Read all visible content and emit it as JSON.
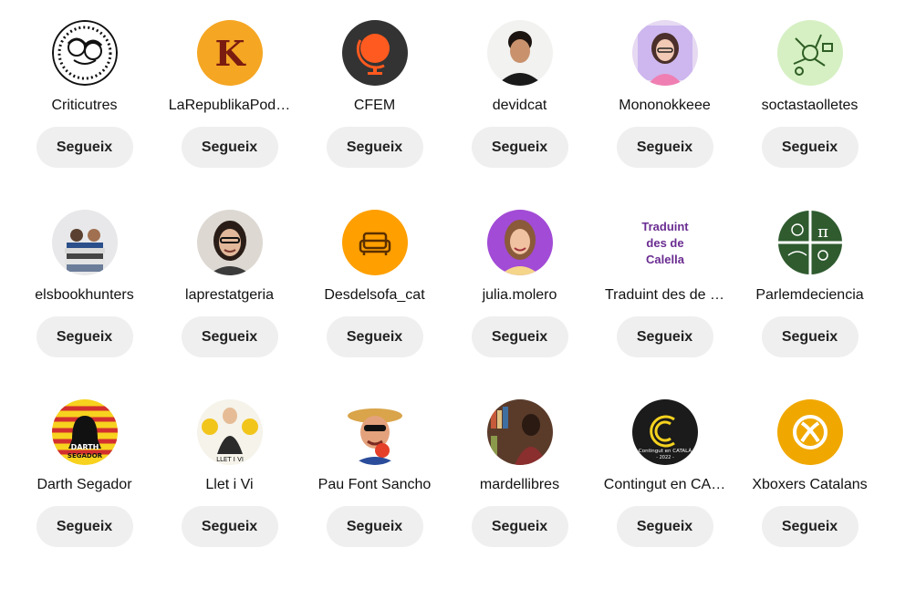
{
  "follow_label": "Segueix",
  "accounts": [
    {
      "name": "Criticutres",
      "avatar": "criticutres-logo"
    },
    {
      "name": "LaRepublikaPod…",
      "avatar": "letter-k-logo",
      "badge": "K"
    },
    {
      "name": "CFEM",
      "avatar": "globe-logo"
    },
    {
      "name": "devidcat",
      "avatar": "man-portrait"
    },
    {
      "name": "Mononokkeee",
      "avatar": "cartoon-girl"
    },
    {
      "name": "soctastaolletes",
      "avatar": "science-doodles"
    },
    {
      "name": "elsbookhunters",
      "avatar": "book-stack-photo"
    },
    {
      "name": "laprestatgeria",
      "avatar": "woman-glasses-photo"
    },
    {
      "name": "Desdelsofa_cat",
      "avatar": "sofa-icon"
    },
    {
      "name": "julia.molero",
      "avatar": "woman-purple-photo"
    },
    {
      "name": "Traduint des de …",
      "avatar": "text-logo",
      "logo_text": [
        "Traduint",
        "des de",
        "Calella"
      ]
    },
    {
      "name": "Parlemdeciencia",
      "avatar": "science-quadrants"
    },
    {
      "name": "Darth Segador",
      "avatar": "darth-helmet",
      "logo_text": [
        "DARTH",
        "SEGADOR"
      ]
    },
    {
      "name": "Llet i Vi",
      "avatar": "cartoon-man",
      "logo_text": [
        "LLET I VI"
      ]
    },
    {
      "name": "Pau Font Sancho",
      "avatar": "man-hat-photo"
    },
    {
      "name": "mardellibres",
      "avatar": "bookshelf-photo"
    },
    {
      "name": "Contingut en CA…",
      "avatar": "c-logo",
      "logo_text": [
        "Contingut en CATALÀ",
        "- 2022 -"
      ]
    },
    {
      "name": "Xboxers Catalans",
      "avatar": "xbox-logo"
    }
  ],
  "colors": {
    "button_bg": "#efefef",
    "k_bg": "#f5a623",
    "globe_bg": "#333333",
    "globe_accent": "#ff5a1f",
    "sofa_bg": "#ff9f00",
    "purple_text": "#6a2c91",
    "xbox_bg": "#f0a800"
  }
}
